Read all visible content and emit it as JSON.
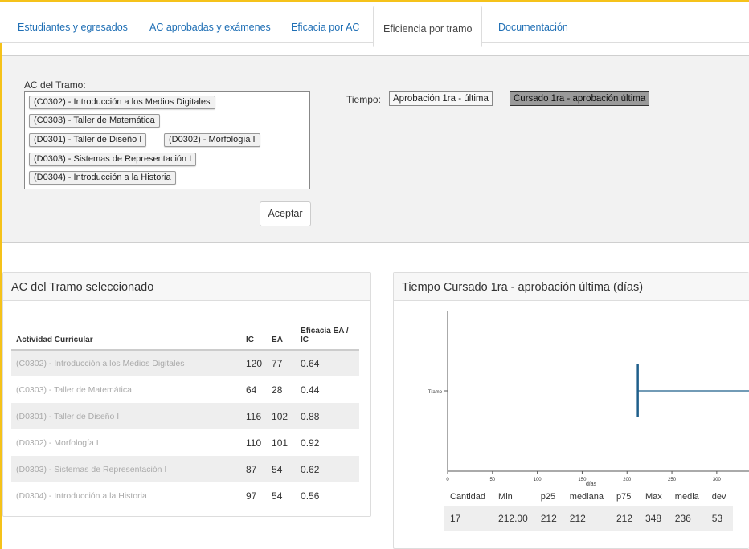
{
  "tabs": [
    {
      "label": "Estudiantes y egresados"
    },
    {
      "label": "AC aprobadas y exámenes"
    },
    {
      "label": "Eficacia por AC"
    },
    {
      "label": "Eficiencia por tramo"
    },
    {
      "label": "Documentación"
    }
  ],
  "filter": {
    "ac_label": "AC del Tramo:",
    "chips": [
      "(C0302) - Introducción a los Medios Digitales",
      "(C0303) - Taller de Matemática",
      "(D0301) - Taller de Diseño I",
      "(D0302) - Morfología I",
      "(D0303) - Sistemas de Representación I",
      "(D0304) - Introducción a la Historia"
    ],
    "accept_label": "Aceptar",
    "time_label": "Tiempo:",
    "time_options": [
      {
        "label": "Aprobación 1ra - última",
        "selected": false
      },
      {
        "label": "Cursado 1ra - aprobación última",
        "selected": true
      }
    ]
  },
  "ac_table": {
    "title": "AC del Tramo seleccionado",
    "headers": [
      "Actividad Curricular",
      "IC",
      "EA",
      "Eficacia EA / IC"
    ],
    "rows": [
      [
        "(C0302) - Introducción a los Medios Digitales",
        "120",
        "77",
        "0.64"
      ],
      [
        "(C0303) - Taller de Matemática",
        "64",
        "28",
        "0.44"
      ],
      [
        "(D0301) - Taller de Diseño I",
        "116",
        "102",
        "0.88"
      ],
      [
        "(D0302) - Morfología I",
        "110",
        "101",
        "0.92"
      ],
      [
        "(D0303) - Sistemas de Representación I",
        "87",
        "54",
        "0.62"
      ],
      [
        "(D0304) - Introducción a la Historia",
        "97",
        "54",
        "0.56"
      ]
    ]
  },
  "time_chart": {
    "title": "Tiempo Cursado 1ra - aprobación última (días)",
    "colors": {
      "mark": "#1f5f8b",
      "axis": "#555555"
    }
  },
  "chart_data": {
    "type": "box",
    "title": "",
    "xlabel": "días",
    "ylabel": "",
    "categories": [
      "Tramo"
    ],
    "xlim": [
      0,
      370
    ],
    "xticks": [
      0,
      50,
      100,
      150,
      200,
      250,
      300
    ],
    "series": [
      {
        "min": 212,
        "max": 348
      }
    ]
  },
  "stats": {
    "headers": [
      "Cantidad",
      "Min",
      "p25",
      "mediana",
      "p75",
      "Max",
      "media",
      "dev"
    ],
    "values": [
      "17",
      "212.00",
      "212",
      "212",
      "212",
      "348",
      "236",
      "53"
    ]
  }
}
